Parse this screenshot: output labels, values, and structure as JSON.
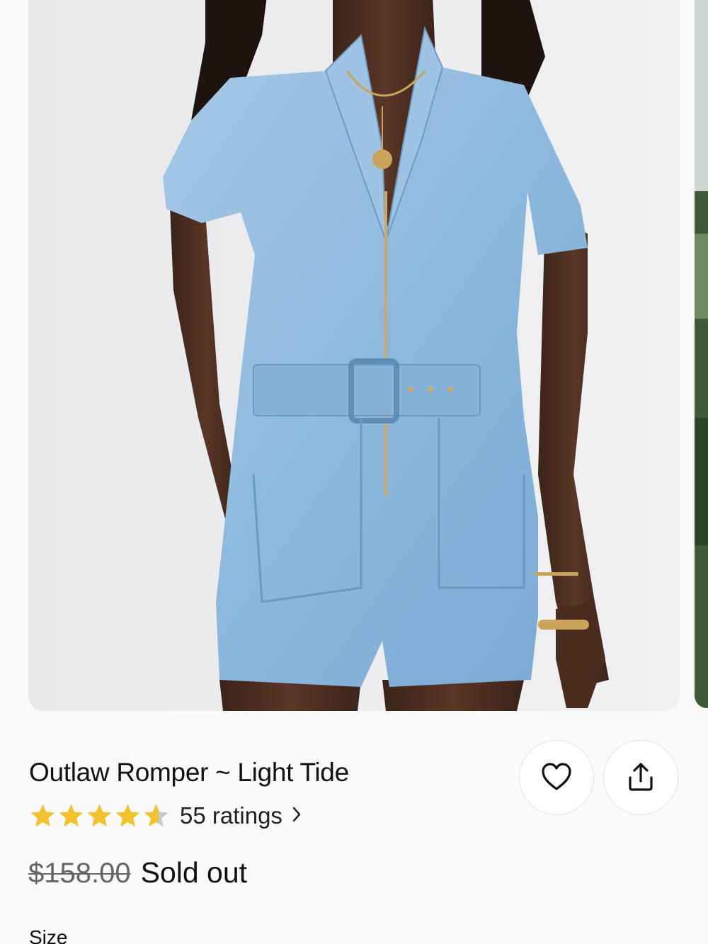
{
  "product": {
    "title": "Outlaw Romper ~ Light Tide",
    "rating": 4.6,
    "rating_max": 5,
    "ratings_count_label": "55 ratings",
    "original_price": "$158.00",
    "availability": "Sold out",
    "size_label": "Size"
  },
  "icons": {
    "favorite": "heart-icon",
    "share": "share-icon",
    "more": "chevron-right-icon",
    "star": "star-icon"
  },
  "colors": {
    "star": "#f2c12e",
    "star_empty": "#c9c9c9",
    "text": "#111111",
    "muted": "#666666",
    "denim": "#8fb8dc"
  }
}
